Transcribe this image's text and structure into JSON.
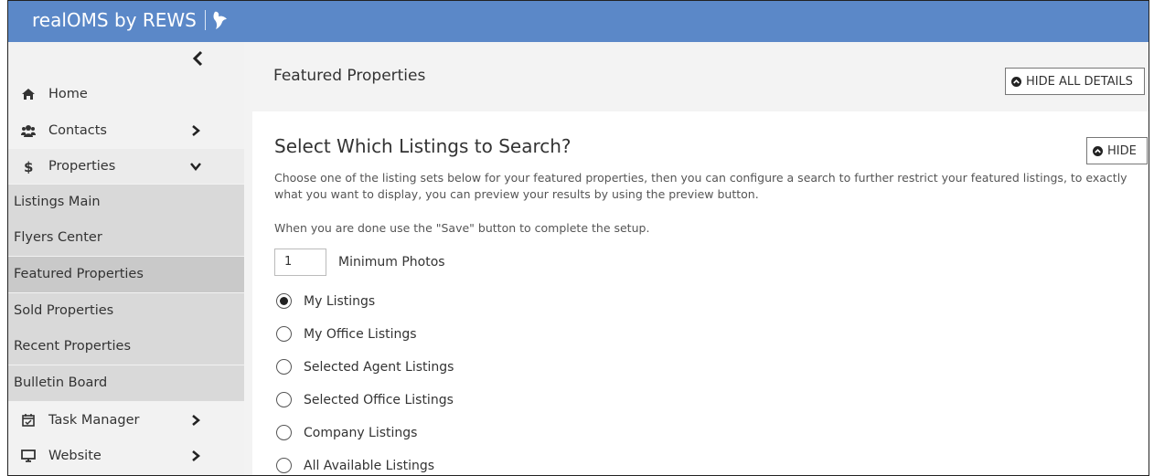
{
  "app": {
    "brand": "realOMS by REWS"
  },
  "sidebar": {
    "items": [
      {
        "label": "Home",
        "icon": "home-icon"
      },
      {
        "label": "Contacts",
        "icon": "users-icon"
      },
      {
        "label": "Properties",
        "icon": "dollar-icon"
      },
      {
        "label": "Task Manager",
        "icon": "calendar-check-icon"
      },
      {
        "label": "Website",
        "icon": "monitor-icon"
      }
    ],
    "subitems": [
      {
        "label": "Listings Main"
      },
      {
        "label": "Flyers Center"
      },
      {
        "label": "Featured Properties"
      },
      {
        "label": "Sold Properties"
      },
      {
        "label": "Recent Properties"
      },
      {
        "label": "Bulletin Board"
      }
    ]
  },
  "page": {
    "title": "Featured Properties",
    "hide_all_label": "HIDE ALL DETAILS"
  },
  "panel": {
    "title": "Select Which Listings to Search?",
    "hide_label": "HIDE",
    "description": "Choose one of the listing sets below for your featured properties, then you can configure a search to further restrict your featured listings, to exactly what you want to display, you can preview your results by using the preview button.",
    "done_note": "When you are done use the \"Save\" button to complete the setup.",
    "min_photos_value": "1",
    "min_photos_label": "Minimum Photos",
    "options": [
      {
        "label": "My Listings",
        "checked": true
      },
      {
        "label": "My Office Listings",
        "checked": false
      },
      {
        "label": "Selected Agent Listings",
        "checked": false
      },
      {
        "label": "Selected Office Listings",
        "checked": false
      },
      {
        "label": "Company Listings",
        "checked": false
      },
      {
        "label": "All Available Listings",
        "checked": false
      }
    ]
  },
  "colors": {
    "topbar": "#5b88c8",
    "sidebar": "#f2f2f2",
    "submenu": "#d9d9d9",
    "submenu_active": "#c9c9c9"
  }
}
